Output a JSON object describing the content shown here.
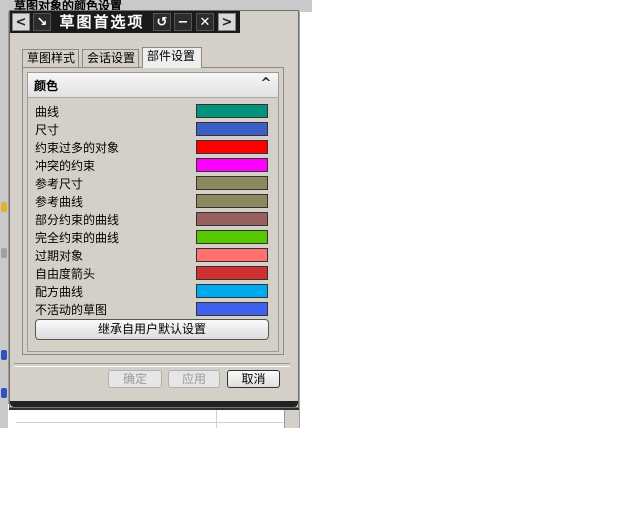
{
  "background_window": {
    "title": "草图对象的颜色设置"
  },
  "dialog": {
    "title": "草图首选项",
    "titlebar_buttons": {
      "back": "<",
      "pin": "↘",
      "reset": "↺",
      "minimize": "−",
      "close": "✕",
      "forward": ">"
    },
    "tabs": [
      {
        "label": "草图样式"
      },
      {
        "label": "会话设置"
      },
      {
        "label": "部件设置",
        "active": true
      }
    ],
    "group": {
      "title": "颜色",
      "collapse_glyph": "^"
    },
    "colors": [
      {
        "label": "曲线",
        "color": "#00957a"
      },
      {
        "label": "尺寸",
        "color": "#3a5fc8"
      },
      {
        "label": "约束过多的对象",
        "color": "#ff0000"
      },
      {
        "label": "冲突的约束",
        "color": "#ff00ff"
      },
      {
        "label": "参考尺寸",
        "color": "#8e8860"
      },
      {
        "label": "参考曲线",
        "color": "#8e8860"
      },
      {
        "label": "部分约束的曲线",
        "color": "#996060"
      },
      {
        "label": "完全约束的曲线",
        "color": "#55c800"
      },
      {
        "label": "过期对象",
        "color": "#ff7070"
      },
      {
        "label": "自由度箭头",
        "color": "#d03030"
      },
      {
        "label": "配方曲线",
        "color": "#00aaee"
      },
      {
        "label": "不活动的草图",
        "color": "#4060f0"
      }
    ],
    "inherit_button": "继承自用户默认设置",
    "buttons": {
      "ok": "确定",
      "apply": "应用",
      "cancel": "取消"
    }
  }
}
